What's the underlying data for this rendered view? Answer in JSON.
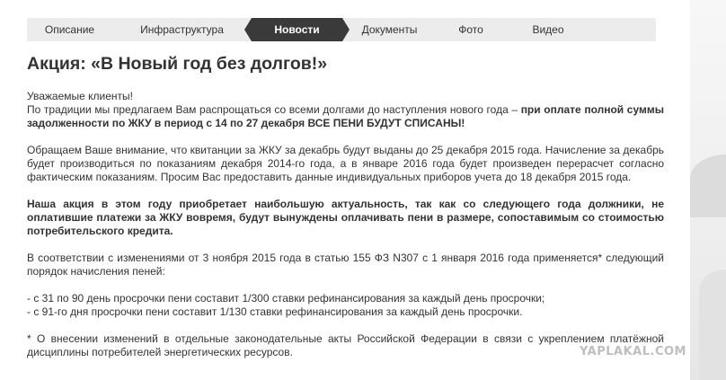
{
  "tabs": [
    {
      "label": "Описание",
      "active": false
    },
    {
      "label": "Инфраструктура",
      "active": false
    },
    {
      "label": "Новости",
      "active": true
    },
    {
      "label": "Документы",
      "active": false
    },
    {
      "label": "Фото",
      "active": false
    },
    {
      "label": "Видео",
      "active": false
    }
  ],
  "article": {
    "title": "Акция: «В Новый год без долгов!»",
    "greeting": "Уважаемые клиенты!",
    "p1_text": "По традиции мы предлагаем Вам распрощаться со всеми долгами до наступления нового года – ",
    "p1_bold": "при оплате полной суммы задолженности по ЖКУ в период с 14 по 27 декабря ВСЕ ПЕНИ БУДУТ СПИСАНЫ!",
    "p2": "Обращаем Ваше внимание, что квитанции за ЖКУ за декабрь будут выданы до 25 декабря 2015 года. Начисление за декабрь будет производиться по показаниям декабря 2014-го года, а в январе 2016 года будет произведен перерасчет согласно фактическим показаниям. Просим Вас предоставить данные индивидуальных приборов учета до 18 декабря 2015 года.",
    "p3_bold": "Наша акция в этом году приобретает наибольшую актуальность, так как со следующего года должники, не оплатившие платежи за ЖКУ вовремя, будут вынуждены оплачивать пени в размере, сопоставимым со стоимостью потребительского кредита.",
    "p4": "В соответствии с изменениями от 3 ноября 2015 года в статью 155 ФЗ N307 с 1 января 2016 года применяется* следующий порядок начисления пеней:",
    "list_item_1": "- с 31 по 90 день просрочки пени составит 1/300 ставки рефинансирования за каждый день просрочки;",
    "list_item_2": "- с 91-го дня просрочки пени составит 1/130 ставки рефинансирования за каждый день просрочки.",
    "footnote": "* О внесении изменений в отдельные законодательные акты Российской Федерации в связи с укреплением платёжной дисциплины потребителей энергетических ресурсов."
  },
  "watermark": "YAPLAKAL.COM",
  "colors": {
    "tab_bar_bg": "#ececec",
    "tab_active_bg": "#3a3a3a",
    "text": "#333333",
    "watermark": "#b3b3b3"
  }
}
